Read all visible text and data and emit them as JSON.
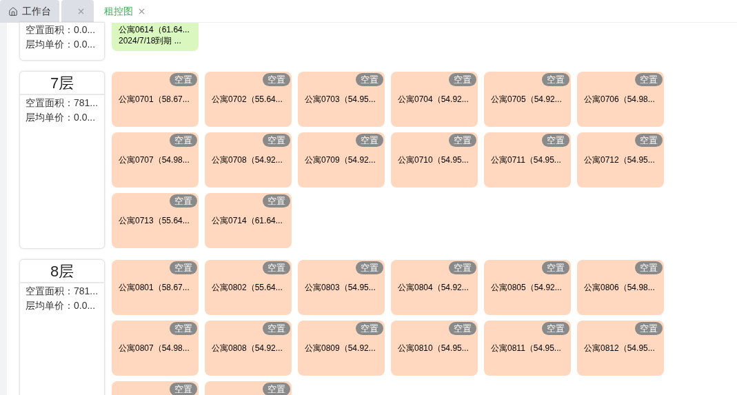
{
  "tabs": [
    {
      "label": "工作台",
      "kind": "home",
      "selected": false
    },
    {
      "kind": "closable",
      "selected": false
    },
    {
      "label": "租控图",
      "kind": "closable",
      "selected": true
    }
  ],
  "floors": [
    {
      "vacant_area": "空置面积：0.0...",
      "avg_price": "层均单价：0.0...",
      "units": [
        {
          "name": "公寓0614（61.64...",
          "note": "2024/7/18到期 ...",
          "color": "#d9f7be"
        }
      ]
    },
    {
      "title": "7层",
      "vacant_area": "空置面积：781...",
      "avg_price": "层均单价：0.0...",
      "units": [
        {
          "name": "公寓0701（58.67...",
          "status": "空置",
          "color": "#ffd8bf"
        },
        {
          "name": "公寓0702（55.64...",
          "status": "空置",
          "color": "#ffd8bf"
        },
        {
          "name": "公寓0703（54.95...",
          "status": "空置",
          "color": "#ffd8bf"
        },
        {
          "name": "公寓0704（54.92...",
          "status": "空置",
          "color": "#ffd8bf"
        },
        {
          "name": "公寓0705（54.92...",
          "status": "空置",
          "color": "#ffd8bf"
        },
        {
          "name": "公寓0706（54.98...",
          "status": "空置",
          "color": "#ffd8bf"
        },
        {
          "name": "公寓0707（54.98...",
          "status": "空置",
          "color": "#ffd8bf"
        },
        {
          "name": "公寓0708（54.92...",
          "status": "空置",
          "color": "#ffd8bf"
        },
        {
          "name": "公寓0709（54.92...",
          "status": "空置",
          "color": "#ffd8bf"
        },
        {
          "name": "公寓0710（54.95...",
          "status": "空置",
          "color": "#ffd8bf"
        },
        {
          "name": "公寓0711（54.95...",
          "status": "空置",
          "color": "#ffd8bf"
        },
        {
          "name": "公寓0712（54.95...",
          "status": "空置",
          "color": "#ffd8bf"
        },
        {
          "name": "公寓0713（55.64...",
          "status": "空置",
          "color": "#ffd8bf"
        },
        {
          "name": "公寓0714（61.64...",
          "status": "空置",
          "color": "#ffd8bf"
        }
      ]
    },
    {
      "title": "8层",
      "vacant_area": "空置面积：781...",
      "avg_price": "层均单价：0.0...",
      "units": [
        {
          "name": "公寓0801（58.67...",
          "status": "空置",
          "color": "#ffd8bf"
        },
        {
          "name": "公寓0802（55.64...",
          "status": "空置",
          "color": "#ffd8bf"
        },
        {
          "name": "公寓0803（54.95...",
          "status": "空置",
          "color": "#ffd8bf"
        },
        {
          "name": "公寓0804（54.92...",
          "status": "空置",
          "color": "#ffd8bf"
        },
        {
          "name": "公寓0805（54.92...",
          "status": "空置",
          "color": "#ffd8bf"
        },
        {
          "name": "公寓0806（54.98...",
          "status": "空置",
          "color": "#ffd8bf"
        },
        {
          "name": "公寓0807（54.98...",
          "status": "空置",
          "color": "#ffd8bf"
        },
        {
          "name": "公寓0808（54.92...",
          "status": "空置",
          "color": "#ffd8bf"
        },
        {
          "name": "公寓0809（54.92...",
          "status": "空置",
          "color": "#ffd8bf"
        },
        {
          "name": "公寓0810（54.95...",
          "status": "空置",
          "color": "#ffd8bf"
        },
        {
          "name": "公寓0811（54.95...",
          "status": "空置",
          "color": "#ffd8bf"
        },
        {
          "name": "公寓0812（54.95...",
          "status": "空置",
          "color": "#ffd8bf"
        },
        {
          "status": "空置",
          "color": "#ffd8bf"
        },
        {
          "status": "空置",
          "color": "#ffd8bf"
        }
      ]
    }
  ]
}
